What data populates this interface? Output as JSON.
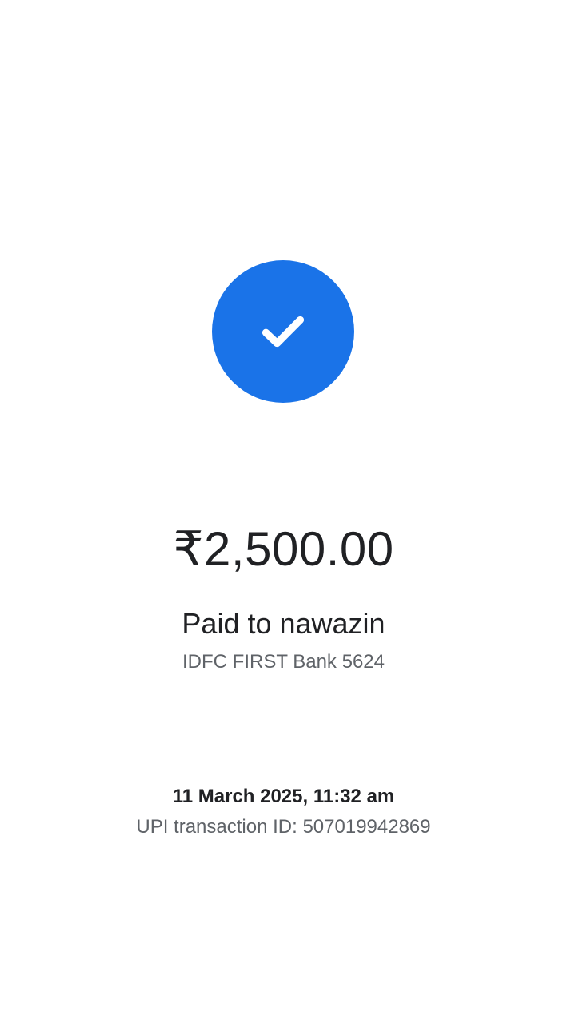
{
  "status": {
    "icon": "check-icon",
    "color": "#1a73e8"
  },
  "payment": {
    "amount": "₹2,500.00",
    "payee_line": "Paid to nawazin",
    "bank_account": "IDFC FIRST Bank 5624",
    "datetime": "11 March 2025, 11:32 am",
    "upi_transaction": "UPI transaction ID: 507019942869"
  }
}
